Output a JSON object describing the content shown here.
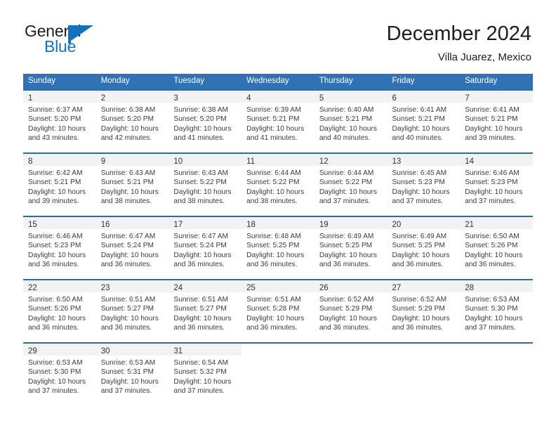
{
  "brand": {
    "name_part1": "General",
    "name_part2": "Blue",
    "mark_icon": "triangle-flag-icon",
    "accent_color": "#1272be"
  },
  "header": {
    "title": "December 2024",
    "subtitle": "Villa Juarez, Mexico"
  },
  "theme": {
    "header_blue": "#3072b4",
    "row_border": "#2f6ba6",
    "daynum_band": "#f2f2f2"
  },
  "calendar": {
    "weekday_headers": [
      "Sunday",
      "Monday",
      "Tuesday",
      "Wednesday",
      "Thursday",
      "Friday",
      "Saturday"
    ],
    "weeks": [
      [
        {
          "day": "1",
          "sunrise": "Sunrise: 6:37 AM",
          "sunset": "Sunset: 5:20 PM",
          "daylight_line1": "Daylight: 10 hours",
          "daylight_line2": "and 43 minutes."
        },
        {
          "day": "2",
          "sunrise": "Sunrise: 6:38 AM",
          "sunset": "Sunset: 5:20 PM",
          "daylight_line1": "Daylight: 10 hours",
          "daylight_line2": "and 42 minutes."
        },
        {
          "day": "3",
          "sunrise": "Sunrise: 6:38 AM",
          "sunset": "Sunset: 5:20 PM",
          "daylight_line1": "Daylight: 10 hours",
          "daylight_line2": "and 41 minutes."
        },
        {
          "day": "4",
          "sunrise": "Sunrise: 6:39 AM",
          "sunset": "Sunset: 5:21 PM",
          "daylight_line1": "Daylight: 10 hours",
          "daylight_line2": "and 41 minutes."
        },
        {
          "day": "5",
          "sunrise": "Sunrise: 6:40 AM",
          "sunset": "Sunset: 5:21 PM",
          "daylight_line1": "Daylight: 10 hours",
          "daylight_line2": "and 40 minutes."
        },
        {
          "day": "6",
          "sunrise": "Sunrise: 6:41 AM",
          "sunset": "Sunset: 5:21 PM",
          "daylight_line1": "Daylight: 10 hours",
          "daylight_line2": "and 40 minutes."
        },
        {
          "day": "7",
          "sunrise": "Sunrise: 6:41 AM",
          "sunset": "Sunset: 5:21 PM",
          "daylight_line1": "Daylight: 10 hours",
          "daylight_line2": "and 39 minutes."
        }
      ],
      [
        {
          "day": "8",
          "sunrise": "Sunrise: 6:42 AM",
          "sunset": "Sunset: 5:21 PM",
          "daylight_line1": "Daylight: 10 hours",
          "daylight_line2": "and 39 minutes."
        },
        {
          "day": "9",
          "sunrise": "Sunrise: 6:43 AM",
          "sunset": "Sunset: 5:21 PM",
          "daylight_line1": "Daylight: 10 hours",
          "daylight_line2": "and 38 minutes."
        },
        {
          "day": "10",
          "sunrise": "Sunrise: 6:43 AM",
          "sunset": "Sunset: 5:22 PM",
          "daylight_line1": "Daylight: 10 hours",
          "daylight_line2": "and 38 minutes."
        },
        {
          "day": "11",
          "sunrise": "Sunrise: 6:44 AM",
          "sunset": "Sunset: 5:22 PM",
          "daylight_line1": "Daylight: 10 hours",
          "daylight_line2": "and 38 minutes."
        },
        {
          "day": "12",
          "sunrise": "Sunrise: 6:44 AM",
          "sunset": "Sunset: 5:22 PM",
          "daylight_line1": "Daylight: 10 hours",
          "daylight_line2": "and 37 minutes."
        },
        {
          "day": "13",
          "sunrise": "Sunrise: 6:45 AM",
          "sunset": "Sunset: 5:23 PM",
          "daylight_line1": "Daylight: 10 hours",
          "daylight_line2": "and 37 minutes."
        },
        {
          "day": "14",
          "sunrise": "Sunrise: 6:46 AM",
          "sunset": "Sunset: 5:23 PM",
          "daylight_line1": "Daylight: 10 hours",
          "daylight_line2": "and 37 minutes."
        }
      ],
      [
        {
          "day": "15",
          "sunrise": "Sunrise: 6:46 AM",
          "sunset": "Sunset: 5:23 PM",
          "daylight_line1": "Daylight: 10 hours",
          "daylight_line2": "and 36 minutes."
        },
        {
          "day": "16",
          "sunrise": "Sunrise: 6:47 AM",
          "sunset": "Sunset: 5:24 PM",
          "daylight_line1": "Daylight: 10 hours",
          "daylight_line2": "and 36 minutes."
        },
        {
          "day": "17",
          "sunrise": "Sunrise: 6:47 AM",
          "sunset": "Sunset: 5:24 PM",
          "daylight_line1": "Daylight: 10 hours",
          "daylight_line2": "and 36 minutes."
        },
        {
          "day": "18",
          "sunrise": "Sunrise: 6:48 AM",
          "sunset": "Sunset: 5:25 PM",
          "daylight_line1": "Daylight: 10 hours",
          "daylight_line2": "and 36 minutes."
        },
        {
          "day": "19",
          "sunrise": "Sunrise: 6:49 AM",
          "sunset": "Sunset: 5:25 PM",
          "daylight_line1": "Daylight: 10 hours",
          "daylight_line2": "and 36 minutes."
        },
        {
          "day": "20",
          "sunrise": "Sunrise: 6:49 AM",
          "sunset": "Sunset: 5:25 PM",
          "daylight_line1": "Daylight: 10 hours",
          "daylight_line2": "and 36 minutes."
        },
        {
          "day": "21",
          "sunrise": "Sunrise: 6:50 AM",
          "sunset": "Sunset: 5:26 PM",
          "daylight_line1": "Daylight: 10 hours",
          "daylight_line2": "and 36 minutes."
        }
      ],
      [
        {
          "day": "22",
          "sunrise": "Sunrise: 6:50 AM",
          "sunset": "Sunset: 5:26 PM",
          "daylight_line1": "Daylight: 10 hours",
          "daylight_line2": "and 36 minutes."
        },
        {
          "day": "23",
          "sunrise": "Sunrise: 6:51 AM",
          "sunset": "Sunset: 5:27 PM",
          "daylight_line1": "Daylight: 10 hours",
          "daylight_line2": "and 36 minutes."
        },
        {
          "day": "24",
          "sunrise": "Sunrise: 6:51 AM",
          "sunset": "Sunset: 5:27 PM",
          "daylight_line1": "Daylight: 10 hours",
          "daylight_line2": "and 36 minutes."
        },
        {
          "day": "25",
          "sunrise": "Sunrise: 6:51 AM",
          "sunset": "Sunset: 5:28 PM",
          "daylight_line1": "Daylight: 10 hours",
          "daylight_line2": "and 36 minutes."
        },
        {
          "day": "26",
          "sunrise": "Sunrise: 6:52 AM",
          "sunset": "Sunset: 5:29 PM",
          "daylight_line1": "Daylight: 10 hours",
          "daylight_line2": "and 36 minutes."
        },
        {
          "day": "27",
          "sunrise": "Sunrise: 6:52 AM",
          "sunset": "Sunset: 5:29 PM",
          "daylight_line1": "Daylight: 10 hours",
          "daylight_line2": "and 36 minutes."
        },
        {
          "day": "28",
          "sunrise": "Sunrise: 6:53 AM",
          "sunset": "Sunset: 5:30 PM",
          "daylight_line1": "Daylight: 10 hours",
          "daylight_line2": "and 37 minutes."
        }
      ],
      [
        {
          "day": "29",
          "sunrise": "Sunrise: 6:53 AM",
          "sunset": "Sunset: 5:30 PM",
          "daylight_line1": "Daylight: 10 hours",
          "daylight_line2": "and 37 minutes."
        },
        {
          "day": "30",
          "sunrise": "Sunrise: 6:53 AM",
          "sunset": "Sunset: 5:31 PM",
          "daylight_line1": "Daylight: 10 hours",
          "daylight_line2": "and 37 minutes."
        },
        {
          "day": "31",
          "sunrise": "Sunrise: 6:54 AM",
          "sunset": "Sunset: 5:32 PM",
          "daylight_line1": "Daylight: 10 hours",
          "daylight_line2": "and 37 minutes."
        },
        null,
        null,
        null,
        null
      ]
    ]
  }
}
